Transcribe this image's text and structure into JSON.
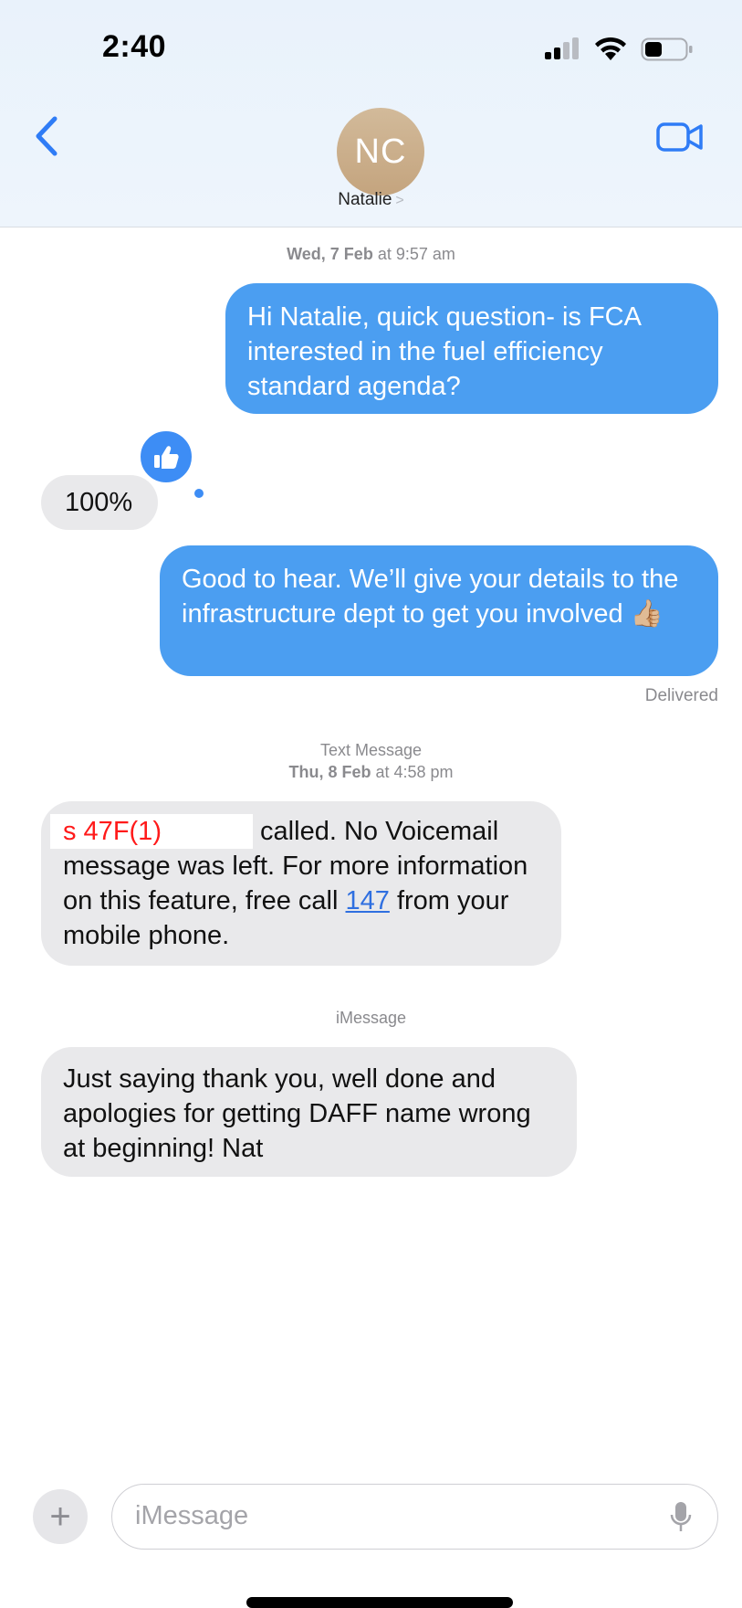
{
  "status_bar": {
    "time": "2:40"
  },
  "header": {
    "avatar_initials": "NC",
    "contact_name": "Natalie",
    "contact_chevron": ">",
    "icons": [
      "back-chevron-icon",
      "video-camera-icon"
    ]
  },
  "conversation": {
    "timestamp_1": {
      "day": "Wed, 7 Feb",
      "at": " at ",
      "time": "9:57 am"
    },
    "msg_out_1": "Hi Natalie, quick question- is FCA interested in the fuel efficiency standard agenda?",
    "msg_in_1": "100%",
    "tapback_icon": "thumbs-up-icon",
    "msg_out_2": "Good to hear. We’ll give your details to the infrastructure dept to get you involved 👍🏼",
    "delivered": "Delivered",
    "service_label_sms": "Text Message",
    "timestamp_2": {
      "day": "Thu, 8 Feb",
      "at": " at ",
      "time": "4:58 pm"
    },
    "msg_in_2": {
      "redaction_label": "s 47F(1)",
      "text_a": " called. No Voicemail message was left. For more information on this feature, free call ",
      "link": "147",
      "text_b": " from your mobile phone."
    },
    "service_label_imessage": "iMessage",
    "msg_in_3": "Just saying thank you, well done and apologies for getting DAFF name wrong at beginning! Nat"
  },
  "composer": {
    "add_button": "+",
    "placeholder": "iMessage",
    "mic_icon": "microphone-icon"
  },
  "colors": {
    "outgoing_bubble": "#4b9ef1",
    "incoming_bubble": "#e9e9eb",
    "link": "#2f6fe0",
    "redaction_text": "#ff1a1a"
  }
}
